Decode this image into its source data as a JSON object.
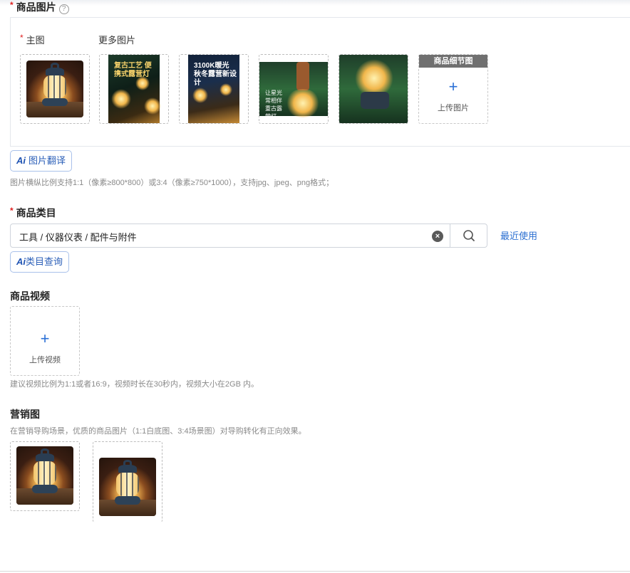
{
  "product_images": {
    "label": "商品图片",
    "help_icon": "?",
    "main_label": "主图",
    "more_label": "更多图片",
    "detail_header": "商品细节图",
    "upload_plus": "+",
    "upload_label": "上传图片",
    "poster1_title": "复古工艺 便携式露营灯",
    "poster2_title": "3100K暖光 秋冬露营新设计",
    "poster3_text": "让星光 常相伴 重古露营灯",
    "ai_translate": "图片翻译",
    "ai_mark": "Ai",
    "hint": "图片横纵比例支持1:1（像素≥800*800）或3:4（像素≥750*1000），支持jpg、jpeg、png格式；"
  },
  "category": {
    "label": "商品类目",
    "value": "工具 / 仪器仪表 / 配件与附件",
    "recent": "最近使用",
    "ai_query": "类目查询",
    "ai_mark": "Ai"
  },
  "video": {
    "label": "商品视频",
    "upload_plus": "+",
    "upload_label": "上传视频",
    "hint": "建议视频比例为1:1或者16:9，视频时长在30秒内，视频大小在2GB 内。"
  },
  "marketing": {
    "label": "营销图",
    "hint": "在营销导购场景，优质的商品图片（1:1白底图、3:4场景图）对导购转化有正向效果。"
  },
  "required_mark": "*"
}
